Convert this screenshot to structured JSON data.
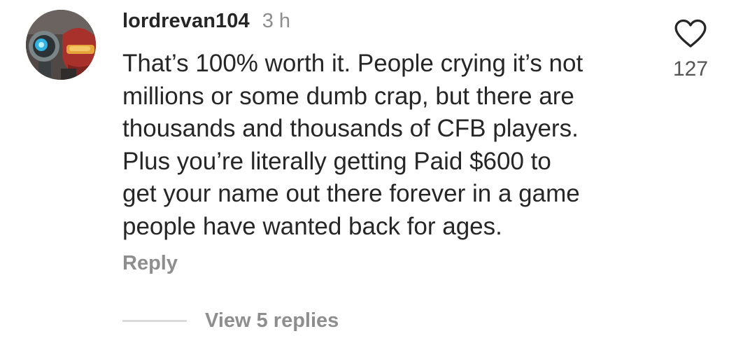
{
  "comment": {
    "username": "lordrevan104",
    "time": "3 h",
    "text": "That’s 100% worth it. People crying it’s not\nmillions or some dumb crap, but there are\nthousands and thousands of CFB players.\nPlus you’re literally getting Paid $600 to\nget your name out there forever in a game\npeople have wanted back for ages.",
    "like_icon": "heart-outline-icon",
    "like_count": "127",
    "reply_label": "Reply",
    "view_replies_label": "View 5 replies"
  }
}
